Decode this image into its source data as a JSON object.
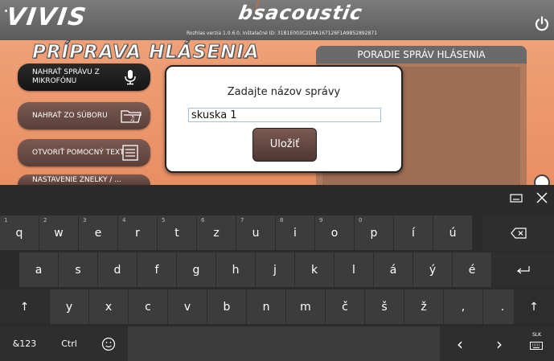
{
  "header": {
    "logo": "VIVIS",
    "brand": "bsacoustic",
    "version": "Rozhlas verzia 1.0.6.0, Inštalačné ID: 31B1E003C2D4A167126F1A9B52892871",
    "power_icon": "power-icon"
  },
  "section_title": "PRÍPRAVA HLÁSENIA",
  "sidebar": {
    "buttons": [
      {
        "label": "NAHRAŤ SPRÁVU Z MIKROFÓNU",
        "icon": "microphone-icon"
      },
      {
        "label": "NAHRAŤ ZO SÚBORU",
        "icon": "folder-music-icon"
      },
      {
        "label": "OTVORIŤ POMOCNÝ TEXT",
        "icon": "text-document-icon"
      },
      {
        "label": "NASTAVENIE ZNELKY / ..."
      }
    ]
  },
  "queue": {
    "header": "PORADIE SPRÁV HLÁSENIA"
  },
  "dialog": {
    "title": "Zadajte názov správy",
    "input_value": "skuska 1",
    "save_label": "Uložiť"
  },
  "keyboard": {
    "row1": [
      {
        "k": "q",
        "n": "1"
      },
      {
        "k": "w",
        "n": "2"
      },
      {
        "k": "e",
        "n": "3"
      },
      {
        "k": "r",
        "n": "4"
      },
      {
        "k": "t",
        "n": "5"
      },
      {
        "k": "z",
        "n": "6"
      },
      {
        "k": "u",
        "n": "7"
      },
      {
        "k": "i",
        "n": "8"
      },
      {
        "k": "o",
        "n": "9"
      },
      {
        "k": "p",
        "n": "0"
      },
      {
        "k": "í",
        "n": ""
      },
      {
        "k": "ú",
        "n": ""
      }
    ],
    "row2": [
      "a",
      "s",
      "d",
      "f",
      "g",
      "h",
      "j",
      "k",
      "l",
      "á",
      "ý",
      "é"
    ],
    "row3": [
      "y",
      "x",
      "c",
      "v",
      "b",
      "n",
      "m",
      "č",
      "š",
      "ž",
      ",",
      "."
    ],
    "mode_key": "&123",
    "ctrl_key": "Ctrl",
    "slk_label": "SLK"
  },
  "colors": {
    "app_bg": "#e88e63",
    "topbar": "#6a6a6a",
    "keyboard_bg": "#2b2b2b",
    "key_bg": "#3c3c3c",
    "dialog_input_border": "#9fc3dc"
  }
}
